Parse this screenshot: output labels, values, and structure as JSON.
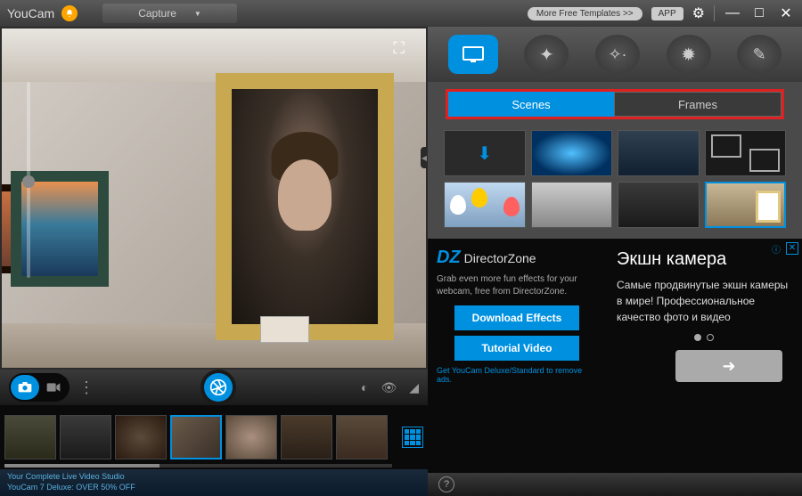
{
  "app": {
    "title": "YouCam"
  },
  "titlebar": {
    "capture_label": "Capture",
    "more_templates": "More Free Templates  >>",
    "app_badge": "APP"
  },
  "controls": {
    "photo_mode": "photo",
    "video_mode": "video"
  },
  "promo": {
    "line1": "Your Complete Live Video Studio",
    "line2": "YouCam 7 Deluxe: OVER 50% OFF"
  },
  "sub_tabs": {
    "scenes": "Scenes",
    "frames": "Frames"
  },
  "ad_left": {
    "brand": "DirectorZone",
    "desc": "Grab even more fun effects for your webcam, free from DirectorZone.",
    "download_btn": "Download Effects",
    "tutorial_btn": "Tutorial Video",
    "remove_ads": "Get YouCam Deluxe/Standard to remove ads."
  },
  "ad_right": {
    "headline": "Экшн камера",
    "body": "Самые продвинутые экшн камеры в мире! Профессиональное качество фото и видео",
    "arrow": "➜"
  },
  "thumbs": {
    "count": 7,
    "selected": 3
  }
}
